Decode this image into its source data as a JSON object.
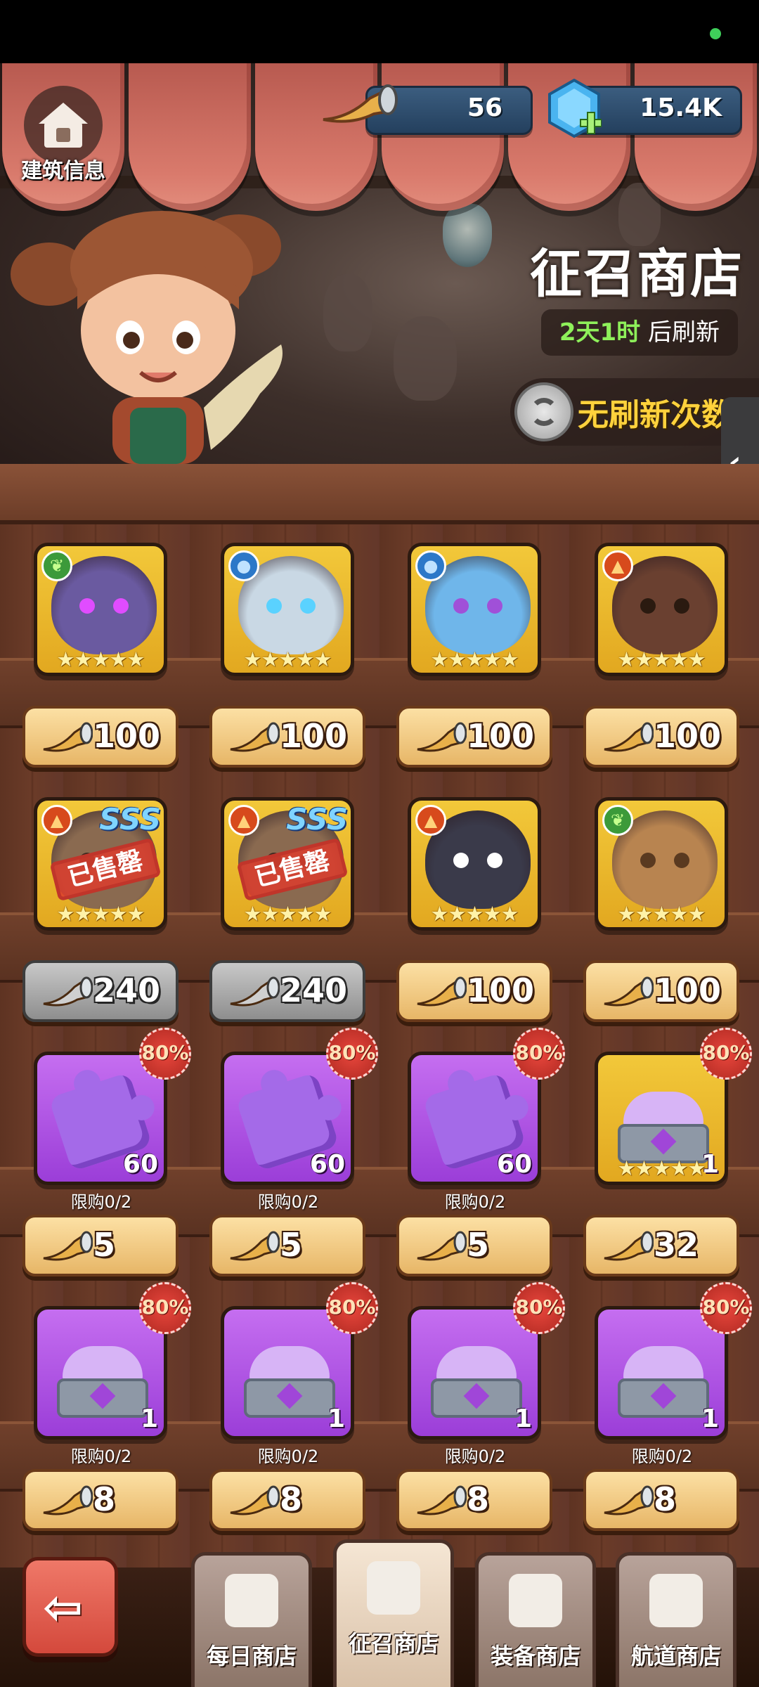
{
  "header": {
    "building_label": "建筑信息",
    "horn_currency": "56",
    "gem_currency": "15.4K"
  },
  "shop": {
    "title": "征召商店",
    "refresh_time": "2天1时",
    "refresh_suffix": "后刷新",
    "refresh_button": "无刷新次数"
  },
  "rows": [
    {
      "items": [
        {
          "kind": "hero",
          "element": "leaf",
          "stars": 5,
          "price": "100",
          "state": "available",
          "palette": [
            "#6a5aa0",
            "#e04cff"
          ]
        },
        {
          "kind": "hero",
          "element": "water",
          "stars": 5,
          "price": "100",
          "state": "available",
          "palette": [
            "#c9d8e4",
            "#5ad2ff"
          ]
        },
        {
          "kind": "hero",
          "element": "water",
          "stars": 5,
          "price": "100",
          "state": "available",
          "palette": [
            "#6fb6ea",
            "#a050d8"
          ]
        },
        {
          "kind": "hero",
          "element": "fire",
          "stars": 5,
          "price": "100",
          "state": "available",
          "palette": [
            "#6a4030",
            "#2a1a10"
          ]
        }
      ]
    },
    {
      "items": [
        {
          "kind": "hero",
          "element": "fire",
          "stars": 5,
          "price": "240",
          "state": "sold",
          "badge": "SSS",
          "sold_label": "已售罄",
          "palette": [
            "#8a6a50",
            "#3a2a20"
          ]
        },
        {
          "kind": "hero",
          "element": "fire",
          "stars": 5,
          "price": "240",
          "state": "sold",
          "badge": "SSS",
          "sold_label": "已售罄",
          "palette": [
            "#8a6a50",
            "#3a2a20"
          ]
        },
        {
          "kind": "hero",
          "element": "fire",
          "stars": 5,
          "price": "100",
          "state": "available",
          "palette": [
            "#3a3a4a",
            "#ffffff"
          ]
        },
        {
          "kind": "hero",
          "element": "leaf",
          "stars": 5,
          "price": "100",
          "state": "available",
          "palette": [
            "#b88450",
            "#5a3a20"
          ]
        }
      ]
    },
    {
      "items": [
        {
          "kind": "shard",
          "quantity": "60",
          "discount": "80%",
          "limit": "限购0/2",
          "price": "5",
          "state": "available"
        },
        {
          "kind": "shard",
          "quantity": "60",
          "discount": "80%",
          "limit": "限购0/2",
          "price": "5",
          "state": "available"
        },
        {
          "kind": "shard",
          "quantity": "60",
          "discount": "80%",
          "limit": "限购0/2",
          "price": "5",
          "state": "available"
        },
        {
          "kind": "chest-gold",
          "quantity": "1",
          "discount": "80%",
          "stars": 5,
          "price": "32",
          "state": "available"
        }
      ]
    },
    {
      "items": [
        {
          "kind": "chest",
          "quantity": "1",
          "discount": "80%",
          "limit": "限购0/2",
          "price": "8",
          "state": "available"
        },
        {
          "kind": "chest",
          "quantity": "1",
          "discount": "80%",
          "limit": "限购0/2",
          "price": "8",
          "state": "available"
        },
        {
          "kind": "chest",
          "quantity": "1",
          "discount": "80%",
          "limit": "限购0/2",
          "price": "8",
          "state": "available"
        },
        {
          "kind": "chest",
          "quantity": "1",
          "discount": "80%",
          "limit": "限购0/2",
          "price": "8",
          "state": "available"
        }
      ]
    }
  ],
  "bottom_nav": {
    "back": "back-arrow-icon",
    "tabs": [
      {
        "label": "每日商店",
        "icon": "shop-stall-icon",
        "active": false
      },
      {
        "label": "征召商店",
        "icon": "horn-icon",
        "active": true
      },
      {
        "label": "装备商店",
        "icon": "shirt-icon",
        "active": false
      },
      {
        "label": "航道商店",
        "icon": "anchor-icon",
        "active": false
      }
    ]
  },
  "colors": {
    "refresh_time_green": "#8ef05a",
    "refresh_button_yellow": "#ffd23c",
    "price_gold": "#e7b667",
    "price_gray": "#8e8e8e"
  }
}
